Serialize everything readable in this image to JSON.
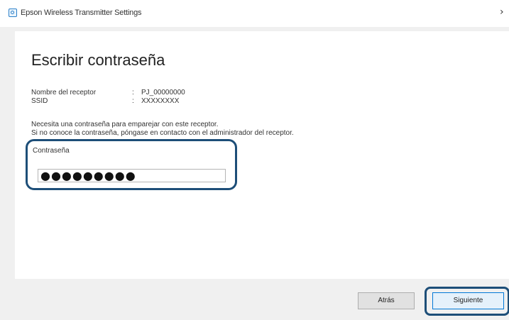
{
  "window": {
    "title": "Epson Wireless Transmitter Settings",
    "close_symbol": "›"
  },
  "page": {
    "heading": "Escribir contraseña",
    "info": [
      {
        "label": "Nombre del receptor",
        "separator": ":",
        "value": "PJ_00000000"
      },
      {
        "label": "SSID",
        "separator": ":",
        "value": "XXXXXXXX"
      }
    ],
    "message_line1": "Necesita una contraseña para emparejar con este receptor.",
    "message_line2": "Si no conoce la contraseña, póngase en contacto con el administrador del receptor.",
    "password_label": "Contraseña",
    "password_value": "●●●●●●●●●"
  },
  "buttons": {
    "back_label": "Atrás",
    "next_label": "Siguiente"
  },
  "colors": {
    "highlight_border": "#1d4e78",
    "next_button_border": "#0078d7"
  },
  "icons": {
    "app": "app-icon",
    "close": "close-icon"
  }
}
